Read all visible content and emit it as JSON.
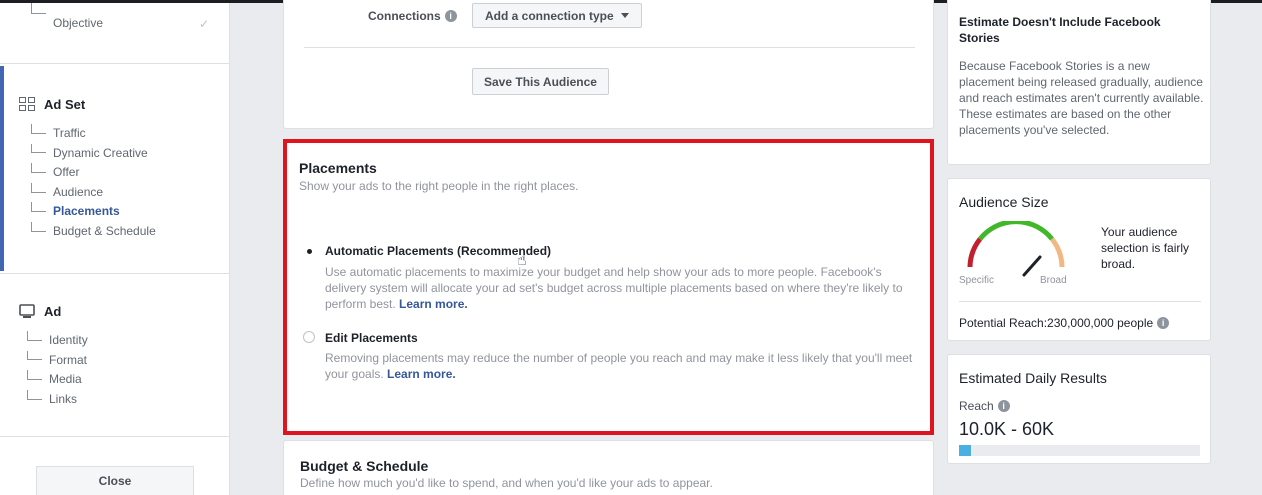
{
  "sidebar": {
    "campaign": {
      "items": [
        {
          "label": "Objective"
        }
      ]
    },
    "ad_set": {
      "title": "Ad Set",
      "items": [
        {
          "label": "Traffic"
        },
        {
          "label": "Dynamic Creative"
        },
        {
          "label": "Offer"
        },
        {
          "label": "Audience"
        },
        {
          "label": "Placements"
        },
        {
          "label": "Budget & Schedule"
        }
      ]
    },
    "ad": {
      "title": "Ad",
      "items": [
        {
          "label": "Identity"
        },
        {
          "label": "Format"
        },
        {
          "label": "Media"
        },
        {
          "label": "Links"
        }
      ]
    },
    "close_label": "Close"
  },
  "audience_card": {
    "connections_label": "Connections",
    "connection_dropdown": "Add a connection type",
    "save_button": "Save This Audience"
  },
  "placements": {
    "title": "Placements",
    "subtitle": "Show your ads to the right people in the right places.",
    "options": [
      {
        "title": "Automatic Placements (Recommended)",
        "description": "Use automatic placements to maximize your budget and help show your ads to more people. Facebook's delivery system will allocate your ad set's budget across multiple placements based on where they're likely to perform best.",
        "link": "Learn more.",
        "selected": true
      },
      {
        "title": "Edit Placements",
        "description": "Removing placements may reduce the number of people you reach and may make it less likely that you'll meet your goals.",
        "link": "Learn more.",
        "selected": false
      }
    ]
  },
  "budget": {
    "title": "Budget & Schedule",
    "subtitle": "Define how much you'd like to spend, and when you'd like your ads to appear."
  },
  "estimate_note": {
    "title": "Estimate Doesn't Include Facebook Stories",
    "body": "Because Facebook Stories is a new placement being released gradually, audience and reach estimates aren't currently available. These estimates are based on the other placements you've selected."
  },
  "audience_size": {
    "title": "Audience Size",
    "gauge_left": "Specific",
    "gauge_right": "Broad",
    "description": "Your audience selection is fairly broad.",
    "potential_reach": "Potential Reach:230,000,000 people"
  },
  "daily_results": {
    "title": "Estimated Daily Results",
    "reach_label": "Reach",
    "reach_value": "10.0K - 60K",
    "reach_fill_percent": 5
  },
  "colors": {
    "accent": "#4267b2",
    "highlight_border": "#e0141e",
    "link": "#365899",
    "reach_bar": "#4ab0e2"
  }
}
